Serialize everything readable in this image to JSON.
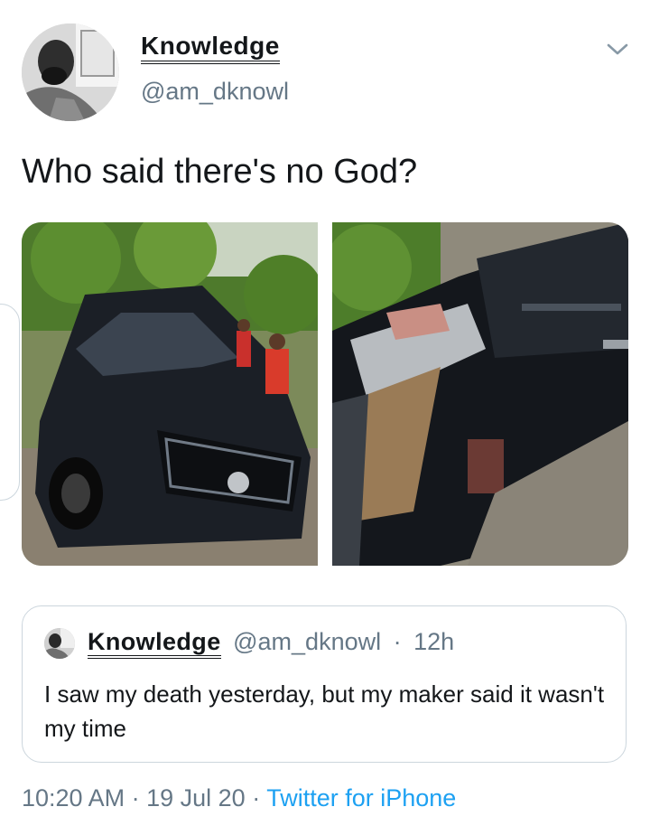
{
  "author": {
    "display_name": "Knowledge",
    "handle": "@am_dknowl"
  },
  "tweet": {
    "text": "Who said there's no God?"
  },
  "menu": {
    "icon": "chevron-down-icon"
  },
  "media": [
    {
      "subject": "wrecked black Toyota pickup"
    },
    {
      "subject": "close-up of crushed car front"
    }
  ],
  "quoted_tweet": {
    "display_name": "Knowledge",
    "handle": "@am_dknowl",
    "separator": "·",
    "age": "12h",
    "text": "I saw my death yesterday, but my maker said it wasn't my time"
  },
  "footer": {
    "time": "10:20 AM",
    "sep1": "·",
    "date": "19 Jul 20",
    "sep2": "·",
    "source": "Twitter for iPhone"
  },
  "colors": {
    "secondary_text": "#657786",
    "link": "#1da1f2",
    "border": "#ccd6dd"
  }
}
